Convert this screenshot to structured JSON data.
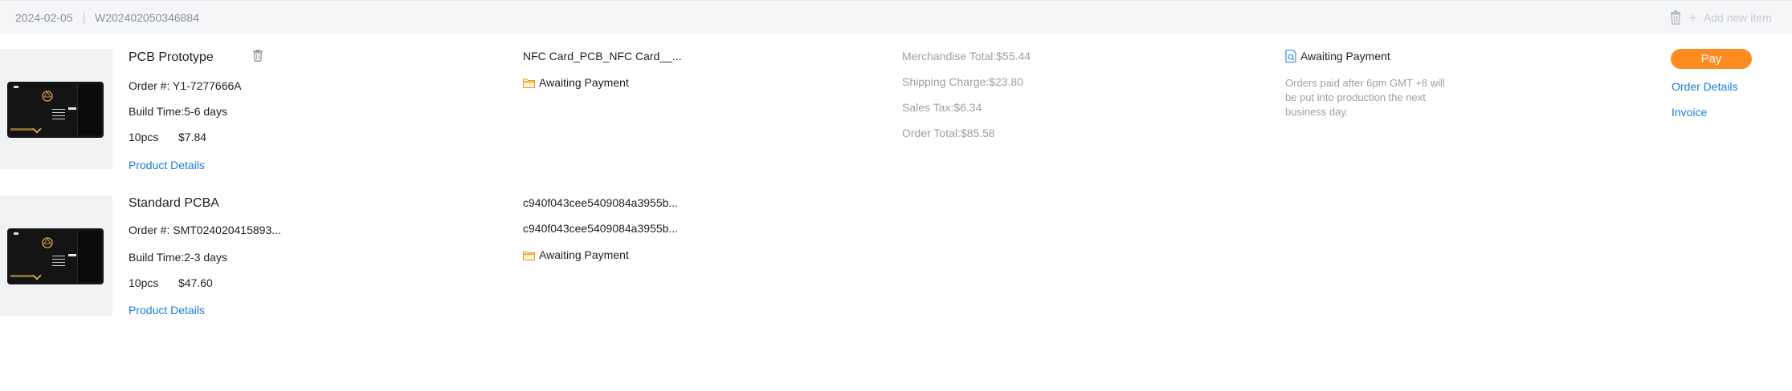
{
  "order": {
    "date": "2024-02-05",
    "separator": "|",
    "number": "W202402050346884",
    "add_new_item_label": "Add new item"
  },
  "items": [
    {
      "product_name": "PCB Prototype",
      "order_no_label": "Order #:",
      "order_no": "Y1-7277666A",
      "build_time_label": "Build Time:",
      "build_time": "5-6 days",
      "quantity": "10pcs",
      "price": "$7.84",
      "details_link": "Product Details",
      "file_name": "NFC Card_PCB_NFC Card__...",
      "status": "Awaiting Payment"
    },
    {
      "product_name": "Standard PCBA",
      "order_no_label": "Order #:",
      "order_no": "SMT024020415893...",
      "build_time_label": "Build Time:",
      "build_time": "2-3 days",
      "quantity": "10pcs",
      "price": "$47.60",
      "details_link": "Product Details",
      "file_name_1": "c940f043cee5409084a3955b...",
      "file_name_2": "c940f043cee5409084a3955b...",
      "status": "Awaiting Payment"
    }
  ],
  "totals": {
    "merchandise": "Merchandise Total:$55.44",
    "shipping": "Shipping Charge:$23.80",
    "tax": "Sales Tax:$6.34",
    "order_total": "Order Total:$85.58"
  },
  "payment": {
    "status": "Awaiting Payment",
    "note": "Orders paid after 6pm GMT +8 will be put into production the next business day."
  },
  "actions": {
    "pay_label": "Pay",
    "order_details_label": "Order Details",
    "invoice_label": "Invoice"
  },
  "colors": {
    "accent_orange": "#ff8a1f",
    "link_blue": "#1a7ed8",
    "header_bg": "#f5f6f8",
    "muted_text": "#9a9fa7"
  },
  "icons": {
    "header_delete": "trash-icon",
    "add": "plus-icon",
    "row_delete": "trash-icon",
    "status": "folder-icon",
    "payment_status": "document-search-icon"
  }
}
